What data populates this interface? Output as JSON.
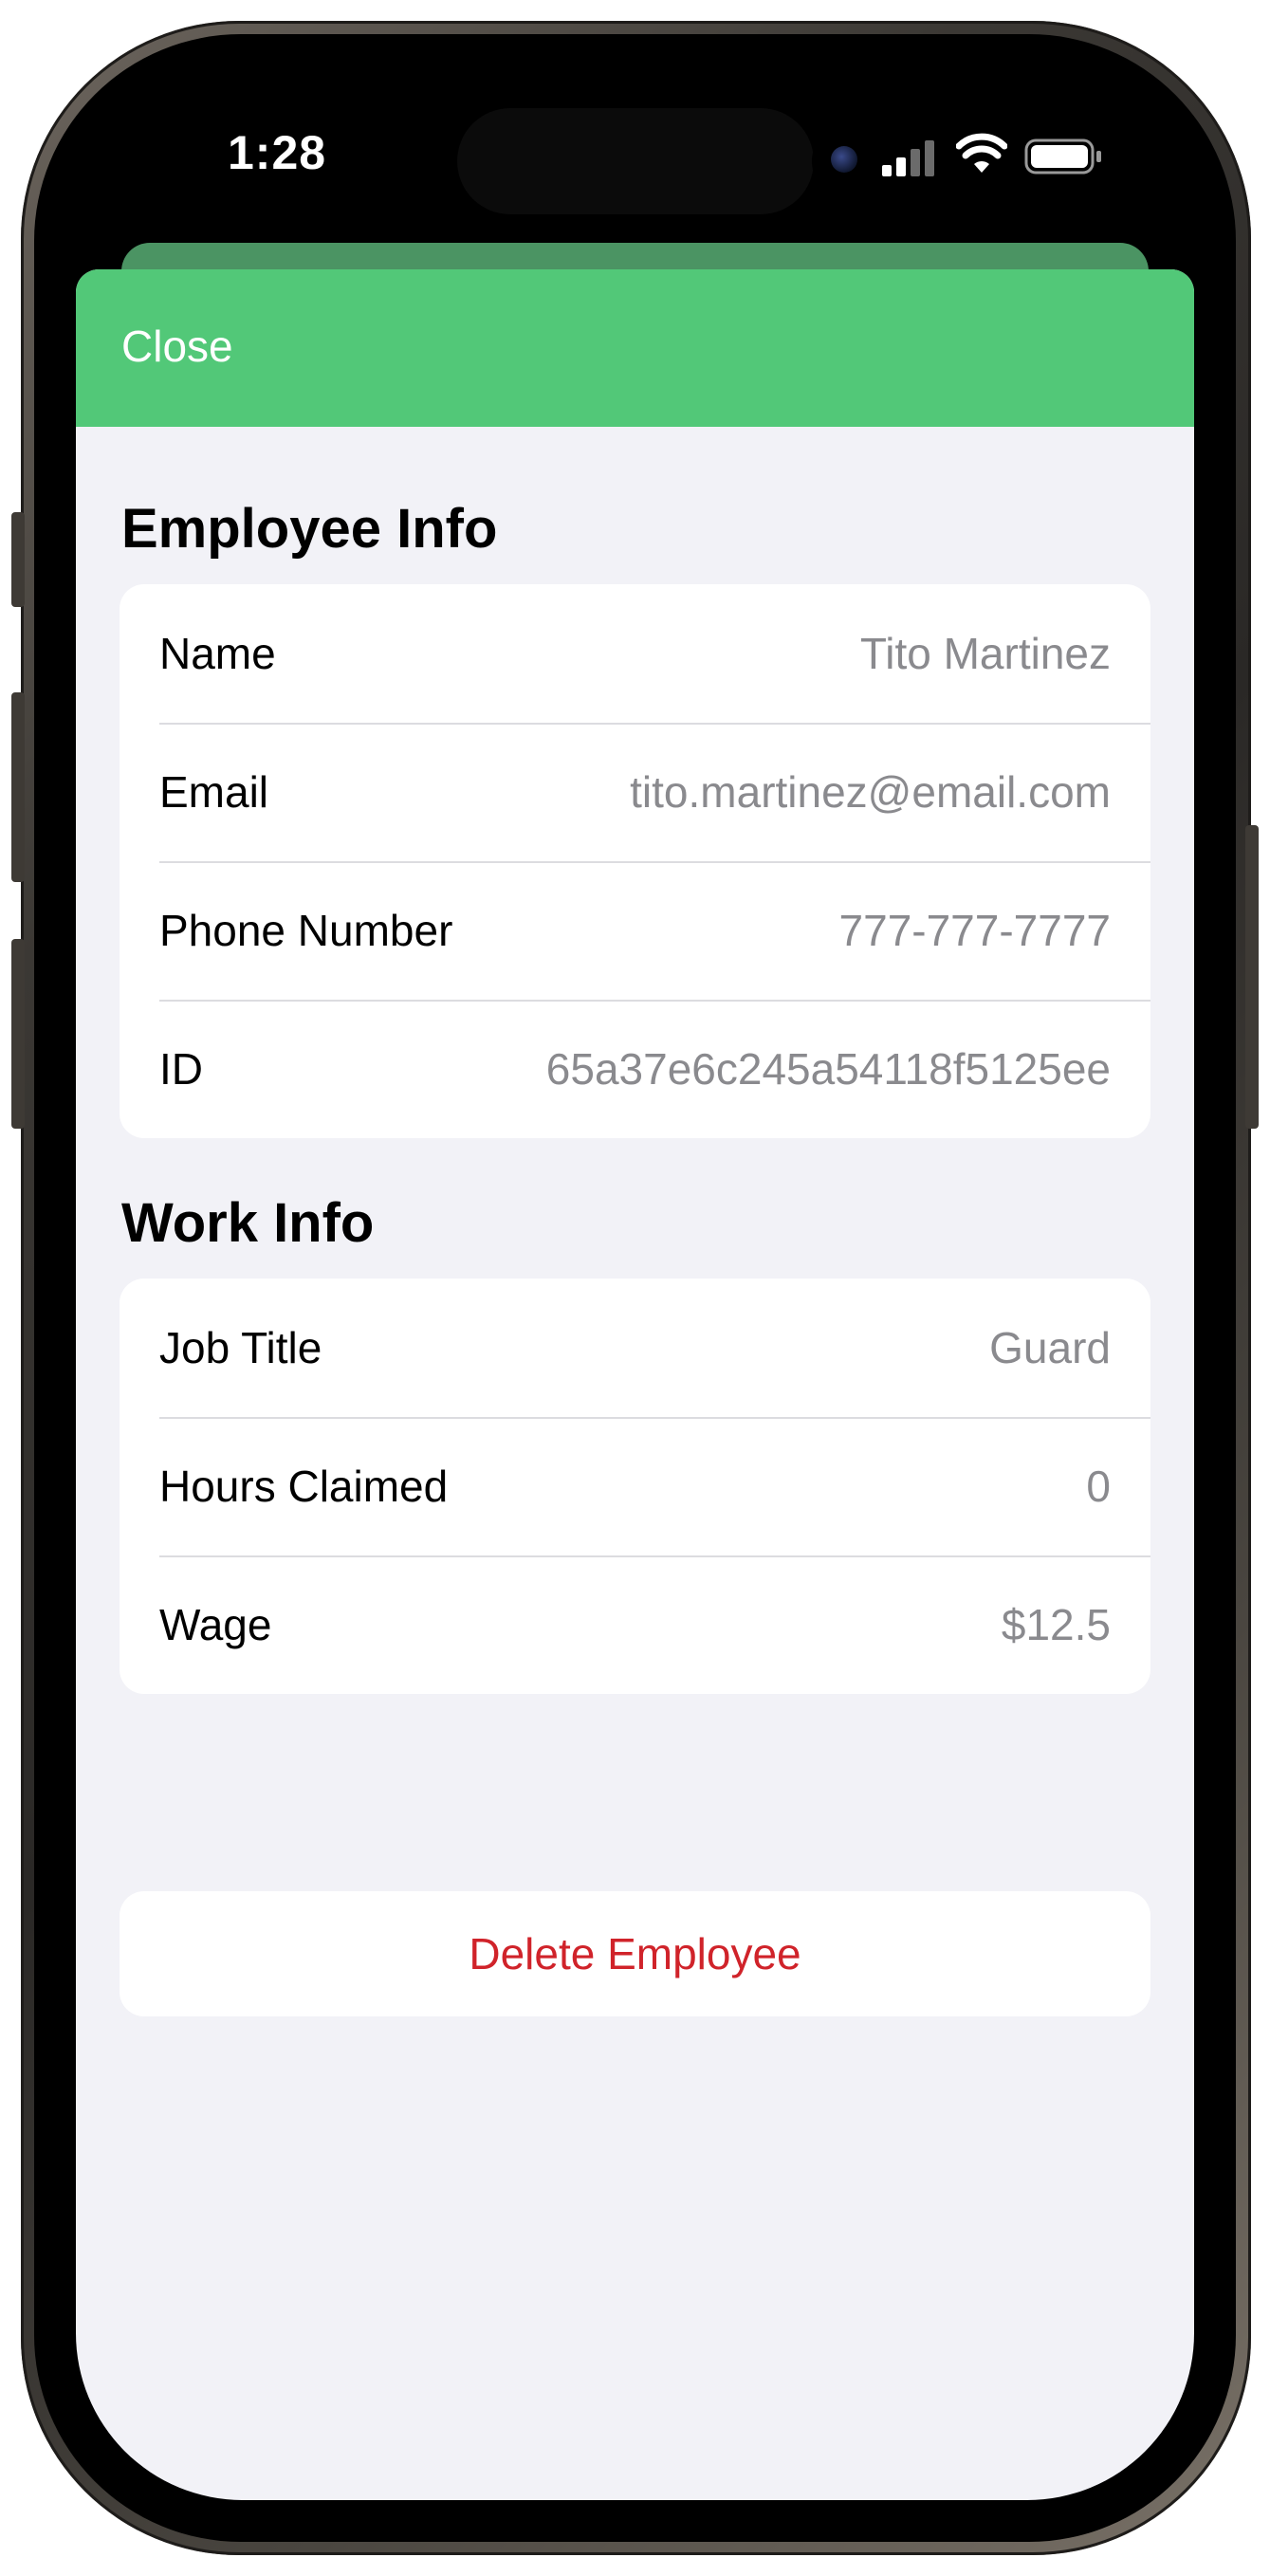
{
  "status_bar": {
    "time": "1:28"
  },
  "nav": {
    "close_label": "Close"
  },
  "employee_info": {
    "title": "Employee Info",
    "rows": [
      {
        "label": "Name",
        "value": "Tito Martinez"
      },
      {
        "label": "Email",
        "value": "tito.martinez@email.com"
      },
      {
        "label": "Phone Number",
        "value": "777-777-7777"
      },
      {
        "label": "ID",
        "value": "65a37e6c245a54118f5125ee"
      }
    ]
  },
  "work_info": {
    "title": "Work Info",
    "rows": [
      {
        "label": "Job Title",
        "value": "Guard"
      },
      {
        "label": "Hours Claimed",
        "value": "0"
      },
      {
        "label": "Wage",
        "value": "$12.5"
      }
    ]
  },
  "actions": {
    "delete_label": "Delete Employee"
  },
  "colors": {
    "nav_green": "#52c878",
    "destructive_red": "#d0232a",
    "background": "#f2f2f7"
  },
  "icons": {
    "signal": "cellular-signal-icon",
    "wifi": "wifi-icon",
    "battery": "battery-icon"
  }
}
